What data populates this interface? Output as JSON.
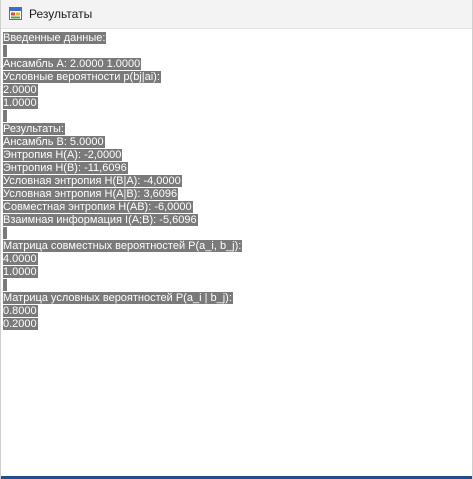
{
  "window": {
    "title": "Результаты",
    "icon": "application-form-icon"
  },
  "output": {
    "lines": [
      "Введенные данные:",
      "",
      "Ансамбль A: 2.0000 1.0000",
      "Условные вероятности p(bj|ai):",
      "2.0000",
      "1.0000",
      "",
      "Результаты:",
      "Ансамбль B: 5.0000",
      "Энтропия H(A): -2,0000",
      "Энтропия H(B): -11,6096",
      "Условная энтропия H(B|A): -4,0000",
      "Условная энтропия H(A|B): 3,6096",
      "Совместная энтропия H(AB): -6,0000",
      "Взаимная информация I(A;B): -5,6096",
      "",
      "Матрица совместных вероятностей P(a_i, b_j):",
      "4.0000",
      "1.0000",
      "",
      "Матрица условных вероятностей P(a_i | b_j):",
      "0.8000",
      "0.2000"
    ]
  },
  "colors": {
    "selection": "#7a7a7a",
    "accent": "#1e4f8c"
  }
}
